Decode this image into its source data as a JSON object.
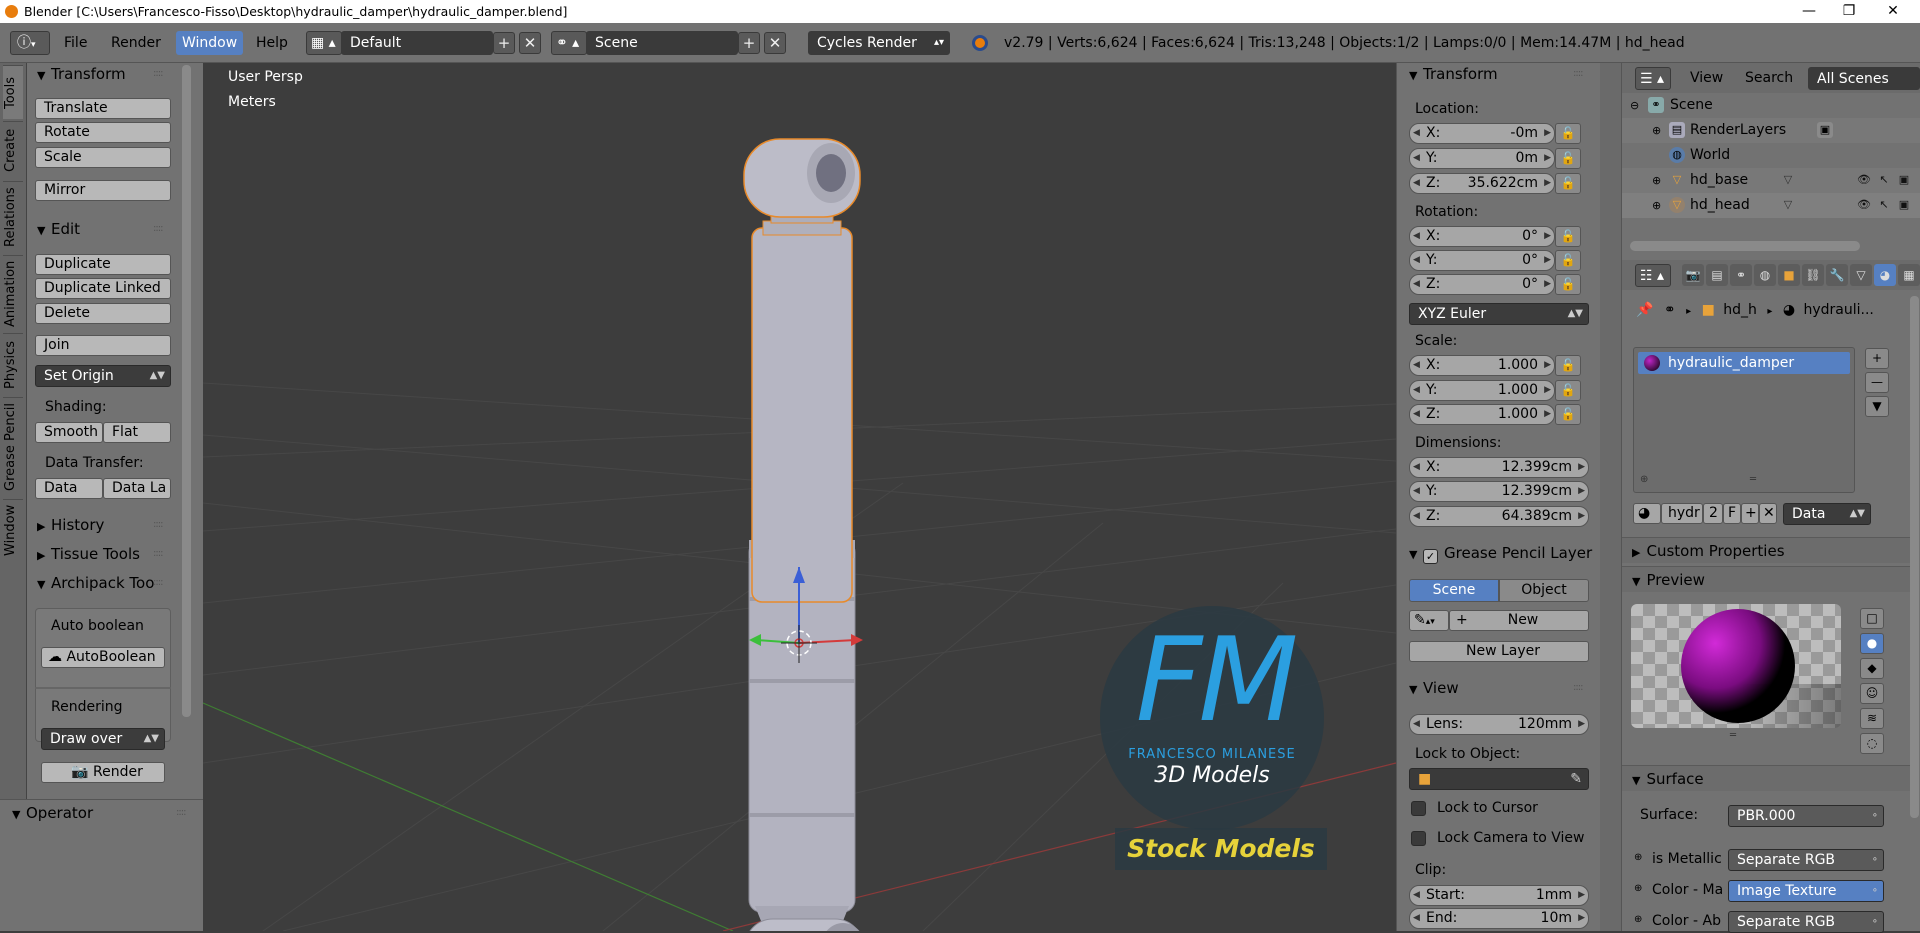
{
  "window": {
    "title": "Blender [C:\\Users\\Francesco-Fisso\\Desktop\\hydraulic_damper\\hydraulic_damper.blend]",
    "minimize": "—",
    "maximize": "❐",
    "close": "✕"
  },
  "menubar": {
    "menus": [
      "File",
      "Render",
      "Window",
      "Help"
    ],
    "active_menu": "Window",
    "screen_layout": "Default",
    "scene": "Scene",
    "render_engine": "Cycles Render",
    "stats": "v2.79 | Verts:6,624 | Faces:6,624 | Tris:13,248 | Objects:1/2 | Lamps:0/0 | Mem:14.47M | hd_head"
  },
  "tool_tabs": [
    "Tools",
    "Create",
    "Relations",
    "Animation",
    "Physics",
    "Grease Pencil",
    "Window"
  ],
  "toolshelf": {
    "transform": {
      "title": "Transform",
      "buttons": [
        "Translate",
        "Rotate",
        "Scale",
        "Mirror"
      ]
    },
    "edit": {
      "title": "Edit",
      "buttons": [
        "Duplicate",
        "Duplicate Linked",
        "Delete",
        "Join"
      ],
      "set_origin": "Set Origin"
    },
    "shading": {
      "label": "Shading:",
      "smooth": "Smooth",
      "flat": "Flat"
    },
    "data_transfer": {
      "label": "Data Transfer:",
      "data": "Data",
      "data_la": "Data La"
    },
    "history": "History",
    "tissue": "Tissue Tools",
    "archipack": {
      "title": "Archipack Too",
      "auto_boolean_label": "Auto boolean",
      "auto_boolean_btn": "AutoBoolean",
      "rendering_label": "Rendering",
      "draw_over": "Draw over",
      "render_btn": "Render"
    },
    "operator": "Operator"
  },
  "viewport": {
    "view_name": "User Persp",
    "units": "Meters",
    "watermark": {
      "initials": "FM",
      "name": "FRANCESCO MILANESE",
      "subtitle": "3D Models",
      "tagline": "Stock Models"
    }
  },
  "npanel": {
    "transform": {
      "title": "Transform",
      "location_label": "Location:",
      "location": [
        {
          "axis": "X:",
          "value": "-0m"
        },
        {
          "axis": "Y:",
          "value": "0m"
        },
        {
          "axis": "Z:",
          "value": "35.622cm"
        }
      ],
      "rotation_label": "Rotation:",
      "rotation": [
        {
          "axis": "X:",
          "value": "0°"
        },
        {
          "axis": "Y:",
          "value": "0°"
        },
        {
          "axis": "Z:",
          "value": "0°"
        }
      ],
      "rotation_mode": "XYZ Euler",
      "scale_label": "Scale:",
      "scale": [
        {
          "axis": "X:",
          "value": "1.000"
        },
        {
          "axis": "Y:",
          "value": "1.000"
        },
        {
          "axis": "Z:",
          "value": "1.000"
        }
      ],
      "dimensions_label": "Dimensions:",
      "dimensions": [
        {
          "axis": "X:",
          "value": "12.399cm"
        },
        {
          "axis": "Y:",
          "value": "12.399cm"
        },
        {
          "axis": "Z:",
          "value": "64.389cm"
        }
      ]
    },
    "grease_pencil": {
      "title": "Grease Pencil Layer",
      "scene": "Scene",
      "object": "Object",
      "new": "New",
      "new_layer": "New Layer"
    },
    "view": {
      "title": "View",
      "lens_label": "Lens:",
      "lens_value": "120mm",
      "lock_to_object": "Lock to Object:",
      "lock_to_cursor": "Lock to Cursor",
      "lock_camera": "Lock Camera to View",
      "clip_label": "Clip:",
      "clip_start_label": "Start:",
      "clip_start": "1mm",
      "clip_end_label": "End:",
      "clip_end": "10m"
    }
  },
  "outliner": {
    "view": "View",
    "search": "Search",
    "filter": "All Scenes",
    "items": [
      {
        "name": "Scene"
      },
      {
        "name": "RenderLayers"
      },
      {
        "name": "World"
      },
      {
        "name": "hd_base"
      },
      {
        "name": "hd_head"
      }
    ]
  },
  "properties": {
    "breadcrumb": {
      "object": "hd_h",
      "material": "hydrauli..."
    },
    "material_slot": "hydraulic_damper",
    "datablock": {
      "name": "hydr",
      "users": "2",
      "fake": "F",
      "link": "Data"
    },
    "custom_properties": "Custom Properties",
    "preview": "Preview",
    "surface": {
      "title": "Surface",
      "surface_label": "Surface:",
      "surface_value": "PBR.000",
      "rows": [
        {
          "label": "is Metallic",
          "value": "Separate RGB"
        },
        {
          "label": "Color - Ma",
          "value": "Image Texture"
        },
        {
          "label": "Color - Ab",
          "value": "Separate RGB"
        }
      ]
    }
  },
  "colors": {
    "accent": "#5680c2",
    "panel": "#727272",
    "viewport": "#3d3d3d",
    "selection": "#e88a2a",
    "watermark_blue": "#2b9fe0",
    "watermark_yellow": "#e6d23a"
  }
}
